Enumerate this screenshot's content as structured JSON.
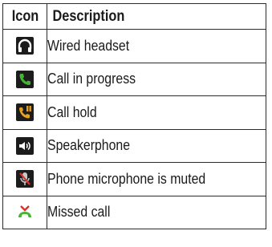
{
  "table": {
    "headers": {
      "icon": "Icon",
      "description": "Description"
    },
    "rows": [
      {
        "icon": "wired-headset-icon",
        "description": "Wired headset"
      },
      {
        "icon": "call-in-progress-icon",
        "description": "Call in progress"
      },
      {
        "icon": "call-hold-icon",
        "description": "Call hold"
      },
      {
        "icon": "speakerphone-icon",
        "description": "Speakerphone"
      },
      {
        "icon": "microphone-muted-icon",
        "description": "Phone microphone is muted"
      },
      {
        "icon": "missed-call-icon",
        "description": "Missed call"
      }
    ]
  },
  "colors": {
    "border": "#2b2b2b",
    "text": "#1a1a1a",
    "icon_background": "#1c1c1c",
    "call_green": "#46b336",
    "hold_orange": "#e8a21a",
    "missed_red": "#d9342b",
    "muted_red": "#d9342b"
  }
}
